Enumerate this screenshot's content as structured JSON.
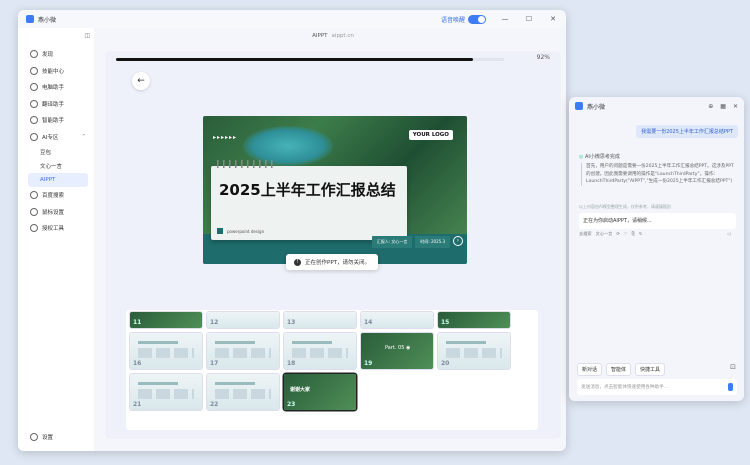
{
  "app": {
    "title": "燕小微",
    "voice_label": "语音唤醒",
    "min": "—",
    "max": "☐",
    "close": "✕"
  },
  "sidebar": {
    "items": [
      "发现",
      "技能中心",
      "电脑助手",
      "翻译助手",
      "智能助手",
      "AI专区"
    ],
    "sub": [
      "豆包",
      "文心一言",
      "AIPPT"
    ],
    "items2": [
      "百度搜索",
      "鼠标设置",
      "授权工具"
    ],
    "settings": "设置"
  },
  "main": {
    "title": "AIPPT",
    "url": "aippt.cn",
    "progress_pct": "92%",
    "progress": 0.92,
    "back_icon": "←"
  },
  "slide": {
    "arrows": "▸▸▸▸▸▸",
    "logo": "YOUR LOGO",
    "title": "2025上半年工作汇报总结",
    "foot": "powerpoint design",
    "pill1": "汇报人: 文心一言",
    "pill2": "时间: 2025.3"
  },
  "toast": {
    "text": "正在创作PPT，请勿关闭。"
  },
  "thumbs": {
    "nums": [
      "11",
      "12",
      "13",
      "14",
      "15",
      "16",
      "17",
      "18",
      "19",
      "20",
      "21",
      "22",
      "23"
    ],
    "t19": "Part. 05 ◉",
    "t23": "谢谢大家"
  },
  "assistant": {
    "title": "燕小微",
    "user_msg": "我需要一份2025上半年工作汇报总结PPT",
    "think": "AI小微思考完成",
    "reply": "首先，用户的问题是需要一份2025上半年工作汇报总结PPT。这涉及PPT的创建。因此我需要调用的操作是“LaunchThirdParty”。操作: LaunchThirdParty(\"AIPPT\",\"生成一份2025上半年工作汇报总结PPT\")",
    "note": "以上内容由AI模型整理生成，仅供参考，请谨慎甄别",
    "bubble": "正在为你启动AIPPT，请稍候...",
    "acts": [
      "去搜索",
      "文心一言",
      "⟳",
      "♡",
      "⎘",
      "↻",
      "◁"
    ],
    "btns": [
      "新对话",
      "智能体",
      "快捷工具"
    ],
    "input_ph": "发送消息，点击智能体快速使用各种助手..."
  }
}
